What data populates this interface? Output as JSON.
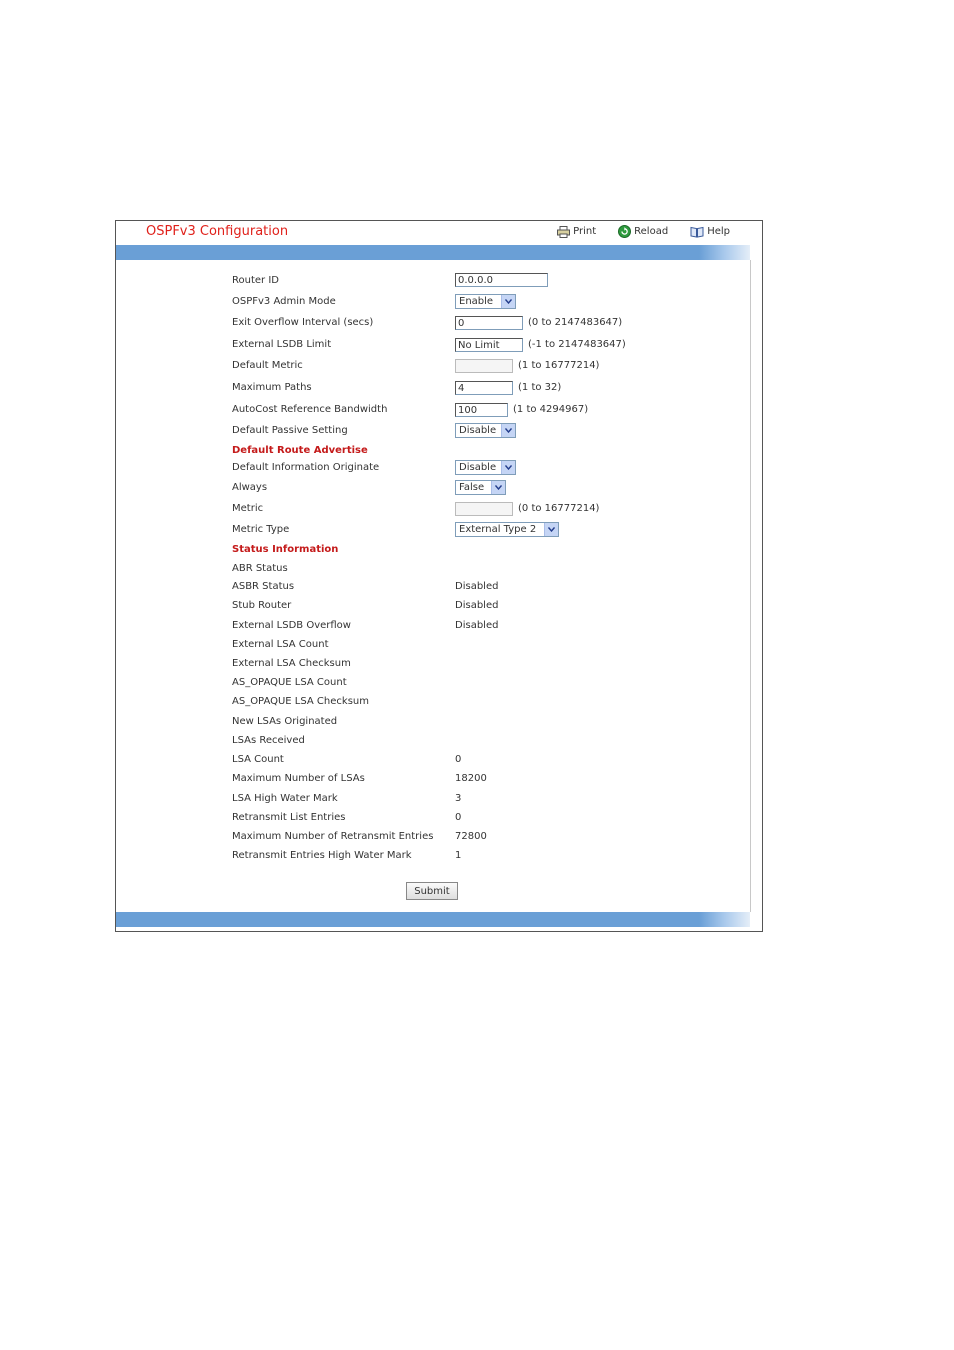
{
  "header": {
    "title": "OSPFv3 Configuration",
    "print_label": "Print",
    "reload_label": "Reload",
    "help_label": "Help"
  },
  "config": {
    "router_id": {
      "label": "Router ID",
      "value": "0.0.0.0"
    },
    "admin_mode": {
      "label": "OSPFv3 Admin Mode",
      "value": "Enable"
    },
    "exit_overflow": {
      "label": "Exit Overflow Interval (secs)",
      "value": "0",
      "range": "(0 to 2147483647)"
    },
    "lsdb_limit": {
      "label": "External LSDB Limit",
      "value": "No Limit",
      "range": "(-1 to 2147483647)"
    },
    "default_metric": {
      "label": "Default Metric",
      "value": "",
      "range": "(1 to 16777214)"
    },
    "max_paths": {
      "label": "Maximum Paths",
      "value": "4",
      "range": "(1 to 32)"
    },
    "autocost": {
      "label": "AutoCost Reference Bandwidth",
      "value": "100",
      "range": "(1 to 4294967)"
    },
    "passive": {
      "label": "Default Passive Setting",
      "value": "Disable"
    }
  },
  "default_route": {
    "heading": "Default Route Advertise",
    "originate": {
      "label": "Default Information Originate",
      "value": "Disable"
    },
    "always": {
      "label": "Always",
      "value": "False"
    },
    "metric": {
      "label": "Metric",
      "value": "",
      "range": "(0 to 16777214)"
    },
    "metric_type": {
      "label": "Metric Type",
      "value": "External Type 2"
    }
  },
  "status": {
    "heading": "Status Information",
    "rows": [
      {
        "label": "ABR Status",
        "value": ""
      },
      {
        "label": "ASBR Status",
        "value": "Disabled"
      },
      {
        "label": "Stub Router",
        "value": "Disabled"
      },
      {
        "label": "External LSDB Overflow",
        "value": "Disabled"
      },
      {
        "label": "External LSA Count",
        "value": ""
      },
      {
        "label": "External LSA Checksum",
        "value": ""
      },
      {
        "label": "AS_OPAQUE LSA Count",
        "value": ""
      },
      {
        "label": "AS_OPAQUE LSA Checksum",
        "value": ""
      },
      {
        "label": "New LSAs Originated",
        "value": ""
      },
      {
        "label": "LSAs Received",
        "value": ""
      },
      {
        "label": "LSA Count",
        "value": "0"
      },
      {
        "label": "Maximum Number of LSAs",
        "value": "18200"
      },
      {
        "label": "LSA High Water Mark",
        "value": "3"
      },
      {
        "label": "Retransmit List Entries",
        "value": "0"
      },
      {
        "label": "Maximum Number of Retransmit Entries",
        "value": "72800"
      },
      {
        "label": "Retransmit Entries High Water Mark",
        "value": "1"
      }
    ]
  },
  "actions": {
    "submit_label": "Submit"
  },
  "colors": {
    "title": "#e0211b",
    "section": "#c41a1a",
    "band": "#6a9fd6"
  },
  "icons": {
    "print": "printer-icon",
    "reload": "reload-icon",
    "help": "help-book-icon"
  }
}
